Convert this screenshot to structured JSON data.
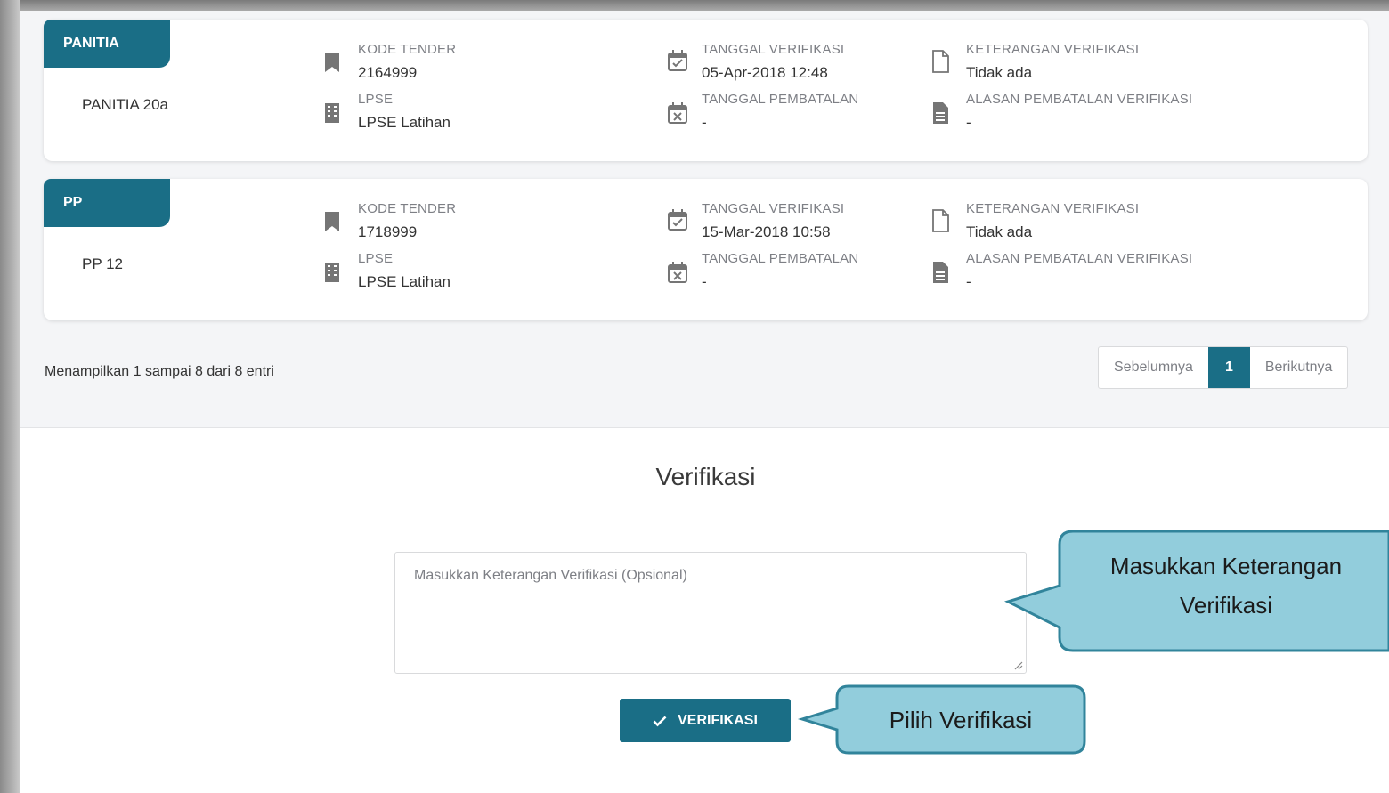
{
  "cards": [
    {
      "role": "PANITIA",
      "name": "PANITIA 20a",
      "kode_tender_label": "KODE TENDER",
      "kode_tender": "2164999",
      "lpse_label": "LPSE",
      "lpse": "LPSE Latihan",
      "tgl_verifikasi_label": "TANGGAL VERIFIKASI",
      "tgl_verifikasi": "05-Apr-2018 12:48",
      "tgl_pembatalan_label": "TANGGAL PEMBATALAN",
      "tgl_pembatalan": "-",
      "ket_verifikasi_label": "KETERANGAN VERIFIKASI",
      "ket_verifikasi": "Tidak ada",
      "alasan_label": "ALASAN PEMBATALAN VERIFIKASI",
      "alasan": "-"
    },
    {
      "role": "PP",
      "name": "PP 12",
      "kode_tender_label": "KODE TENDER",
      "kode_tender": "1718999",
      "lpse_label": "LPSE",
      "lpse": "LPSE Latihan",
      "tgl_verifikasi_label": "TANGGAL VERIFIKASI",
      "tgl_verifikasi": "15-Mar-2018 10:58",
      "tgl_pembatalan_label": "TANGGAL PEMBATALAN",
      "tgl_pembatalan": "-",
      "ket_verifikasi_label": "KETERANGAN VERIFIKASI",
      "ket_verifikasi": "Tidak ada",
      "alasan_label": "ALASAN PEMBATALAN VERIFIKASI",
      "alasan": "-"
    }
  ],
  "table_info": "Menampilkan 1 sampai 8 dari 8 entri",
  "pagination": {
    "prev": "Sebelumnya",
    "current": "1",
    "next": "Berikutnya"
  },
  "verifikasi": {
    "title": "Verifikasi",
    "placeholder": "Masukkan Keterangan Verifikasi (Opsional)",
    "button_label": "VERIFIKASI"
  },
  "callouts": {
    "keterangan_line1": "Masukkan Keterangan",
    "keterangan_line2": "Verifikasi",
    "pilih": "Pilih Verifikasi"
  },
  "colors": {
    "primary": "#1a6e86",
    "callout_fill": "#92cddc",
    "callout_border": "#31849b"
  }
}
